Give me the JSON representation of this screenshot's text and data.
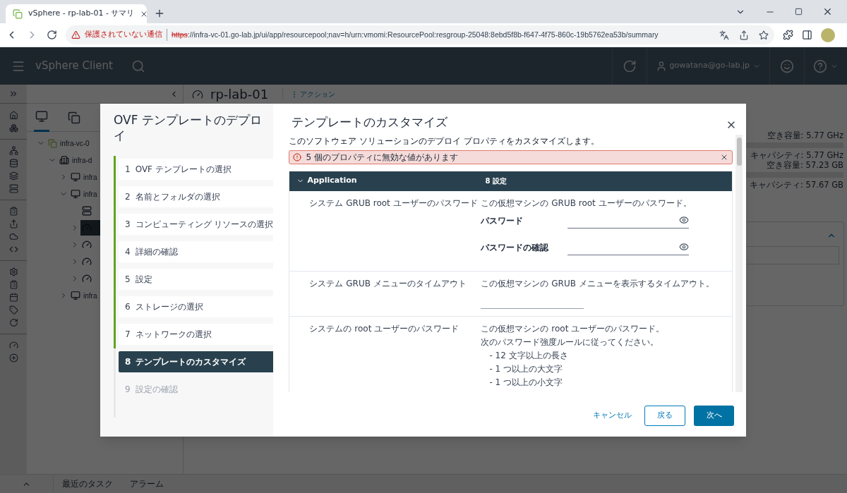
{
  "browser": {
    "tab_title": "vSphere - rp-lab-01 - サマリ",
    "security_warning": "保護されていない通信",
    "url_scheme": "https",
    "url_rest": "://infra-vc-01.go-lab.jp/ui/app/resourcepool;nav=h/urn:vmomi:ResourcePool:resgroup-25048:8ebd5f8b-f647-4f75-860c-19b5762ea53b/summary"
  },
  "header": {
    "app_name": "vSphere Client",
    "user": "gowatana@go-lab.jp"
  },
  "tree": [
    {
      "kind": "vcenter",
      "label": "infra-vc-0",
      "expanded": true,
      "selected": false,
      "children": [
        {
          "kind": "datacenter",
          "label": "infra-d",
          "expanded": true,
          "selected": false,
          "children": [
            {
              "kind": "cluster",
              "label": "infra",
              "expanded": false,
              "selected": false
            },
            {
              "kind": "cluster",
              "label": "infra",
              "expanded": true,
              "selected": false,
              "children": [
                {
                  "kind": "host",
                  "selected": false
                },
                {
                  "kind": "pool",
                  "expanded": false,
                  "selected": true
                },
                {
                  "kind": "pool",
                  "expanded": false,
                  "selected": false
                },
                {
                  "kind": "pool",
                  "expanded": false,
                  "selected": false
                },
                {
                  "kind": "pool",
                  "expanded": false,
                  "selected": false
                }
              ]
            },
            {
              "kind": "cluster",
              "label": "infra",
              "expanded": false,
              "selected": false
            }
          ]
        }
      ]
    }
  ],
  "object": {
    "title": "rp-lab-01",
    "actions": "アクション"
  },
  "summary_lines": [
    "空き容量: 5.77 GHz",
    "キャパシティ: 5.77 GHz",
    "空き容量: 57.23 GB",
    "キャパシティ: 57.67 GB"
  ],
  "bottom_tabs": [
    "最近のタスク",
    "アラーム"
  ],
  "dialog": {
    "wizard_title": "OVF テンプレートのデプロイ",
    "steps": [
      {
        "number": "1",
        "label": "OVF テンプレートの選択",
        "completed": true,
        "selected": false,
        "disabled": false
      },
      {
        "number": "2",
        "label": "名前とフォルダの選択",
        "completed": true,
        "selected": false,
        "disabled": false
      },
      {
        "number": "3",
        "label": "コンピューティング リソースの選択",
        "completed": true,
        "selected": false,
        "disabled": false
      },
      {
        "number": "4",
        "label": "詳細の確認",
        "completed": true,
        "selected": false,
        "disabled": false
      },
      {
        "number": "5",
        "label": "設定",
        "completed": true,
        "selected": false,
        "disabled": false
      },
      {
        "number": "6",
        "label": "ストレージの選択",
        "completed": true,
        "selected": false,
        "disabled": false
      },
      {
        "number": "7",
        "label": "ネットワークの選択",
        "completed": true,
        "selected": false,
        "disabled": false
      },
      {
        "number": "8",
        "label": "テンプレートのカスタマイズ",
        "completed": false,
        "selected": true,
        "disabled": false
      },
      {
        "number": "9",
        "label": "設定の確認",
        "completed": false,
        "selected": false,
        "disabled": true
      }
    ],
    "title": "テンプレートのカスタマイズ",
    "description": "このソフトウェア ソリューションのデプロイ プロパティをカスタマイズします。",
    "alert": "5 個のプロパティに無効な値があります",
    "section": {
      "name": "Application",
      "count": "8 設定",
      "expanded": true
    },
    "properties": [
      {
        "kind": "password",
        "name": "システム GRUB root ユーザーのパスワード",
        "lines": [
          "この仮想マシンの GRUB root ユーザーのパスワード。"
        ],
        "fields": [
          "パスワード",
          "パスワードの確認"
        ]
      },
      {
        "kind": "text",
        "name": "システム GRUB メニューのタイムアウト",
        "lines": [
          "この仮想マシンの GRUB メニューを表示するタイムアウト。"
        ]
      },
      {
        "kind": "rules",
        "name": "システムの root ユーザーのパスワード",
        "lines": [
          "この仮想マシンの root ユーザーのパスワード。",
          "次のパスワード強度ルールに従ってください。"
        ],
        "rules": [
          "- 12 文字以上の長さ",
          "- 1 つ以上の大文字",
          "- 1 つ以上の小文字"
        ]
      }
    ],
    "buttons": {
      "cancel": "キャンセル",
      "back": "戻る",
      "next": "次へ"
    }
  }
}
